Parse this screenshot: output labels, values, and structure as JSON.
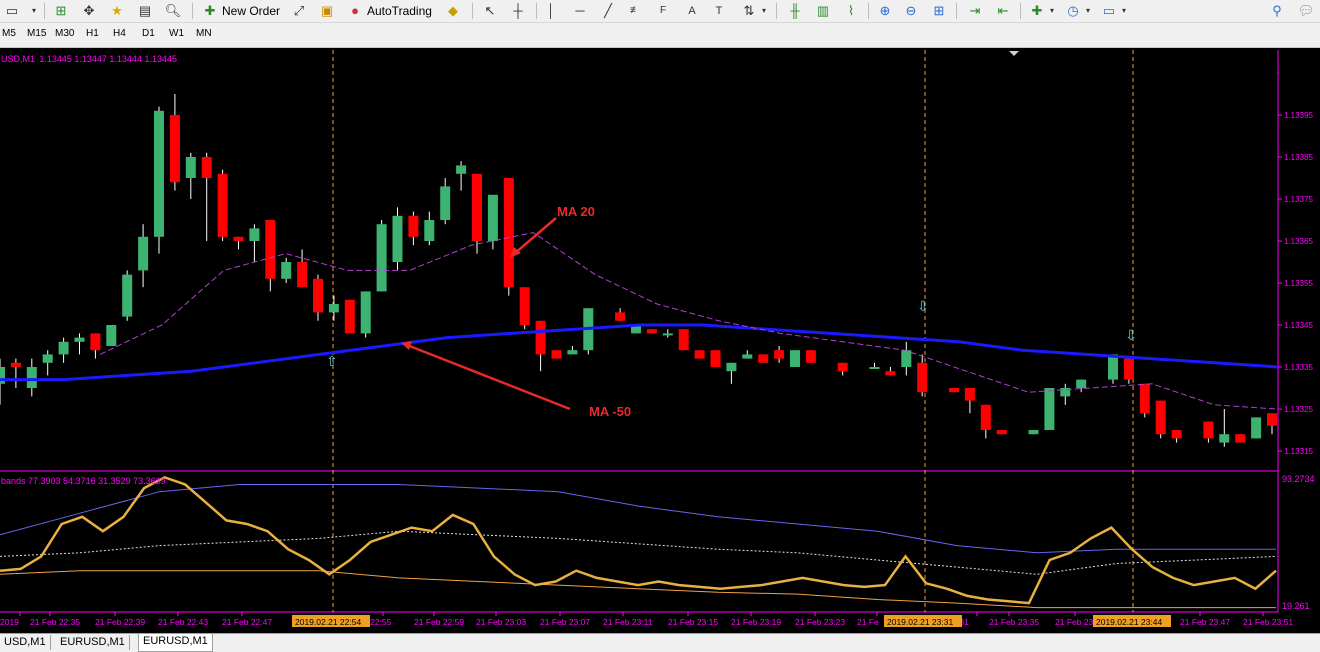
{
  "toolbar": {
    "new_order_label": "New Order",
    "autotrading_label": "AutoTrading"
  },
  "timeframes": [
    "M5",
    "M15",
    "M30",
    "H1",
    "H4",
    "D1",
    "W1",
    "MN"
  ],
  "chart": {
    "symbol_label": "USD,M1",
    "ohlc_text": "1.13445 1.13447 1.13444 1.13445",
    "price_ticks": [
      "1.13405",
      "1.13395",
      "1.13385",
      "1.13375",
      "1.13365",
      "1.13355",
      "1.13345",
      "1.13335",
      "1.13325",
      "1.13315"
    ],
    "current_price": "1.13445",
    "colors": {
      "bull": "#3cb371",
      "bear": "#ff0000",
      "ma_slow": "#1a1aff",
      "ma_fast": "#b040d0",
      "axis": "#ff00ff",
      "vline": "#f0a040"
    },
    "annotations": [
      {
        "text": "MA 20",
        "color": "#e82a2a"
      },
      {
        "text": "MA -50",
        "color": "#e82a2a"
      }
    ],
    "candles": [
      {
        "o": 1.13331,
        "h": 1.13337,
        "l": 1.13326,
        "c": 1.13335
      },
      {
        "o": 1.13336,
        "h": 1.13337,
        "l": 1.1333,
        "c": 1.13335
      },
      {
        "o": 1.1333,
        "h": 1.13337,
        "l": 1.13328,
        "c": 1.13335
      },
      {
        "o": 1.13336,
        "h": 1.13339,
        "l": 1.13333,
        "c": 1.13338
      },
      {
        "o": 1.13338,
        "h": 1.13342,
        "l": 1.13336,
        "c": 1.13341
      },
      {
        "o": 1.13341,
        "h": 1.13343,
        "l": 1.13338,
        "c": 1.13342
      },
      {
        "o": 1.13343,
        "h": 1.13343,
        "l": 1.13337,
        "c": 1.13339
      },
      {
        "o": 1.1334,
        "h": 1.13345,
        "l": 1.1334,
        "c": 1.13345
      },
      {
        "o": 1.13347,
        "h": 1.13358,
        "l": 1.13346,
        "c": 1.13357
      },
      {
        "o": 1.13358,
        "h": 1.13369,
        "l": 1.13354,
        "c": 1.13366
      },
      {
        "o": 1.13366,
        "h": 1.13397,
        "l": 1.13362,
        "c": 1.13396
      },
      {
        "o": 1.13395,
        "h": 1.134,
        "l": 1.13377,
        "c": 1.13379
      },
      {
        "o": 1.1338,
        "h": 1.13386,
        "l": 1.13375,
        "c": 1.13385
      },
      {
        "o": 1.13385,
        "h": 1.13386,
        "l": 1.13365,
        "c": 1.1338
      },
      {
        "o": 1.13381,
        "h": 1.13382,
        "l": 1.13365,
        "c": 1.13366
      },
      {
        "o": 1.13366,
        "h": 1.13366,
        "l": 1.13363,
        "c": 1.13365
      },
      {
        "o": 1.13365,
        "h": 1.13369,
        "l": 1.1336,
        "c": 1.13368
      },
      {
        "o": 1.1337,
        "h": 1.1337,
        "l": 1.13353,
        "c": 1.13356
      },
      {
        "o": 1.13356,
        "h": 1.13361,
        "l": 1.13355,
        "c": 1.1336
      },
      {
        "o": 1.1336,
        "h": 1.13363,
        "l": 1.13354,
        "c": 1.13354
      },
      {
        "o": 1.13356,
        "h": 1.13357,
        "l": 1.13346,
        "c": 1.13348
      },
      {
        "o": 1.13348,
        "h": 1.13352,
        "l": 1.13346,
        "c": 1.1335
      },
      {
        "o": 1.13351,
        "h": 1.13351,
        "l": 1.13343,
        "c": 1.13343
      },
      {
        "o": 1.13343,
        "h": 1.13353,
        "l": 1.13342,
        "c": 1.13353
      },
      {
        "o": 1.13353,
        "h": 1.1337,
        "l": 1.13353,
        "c": 1.13369
      },
      {
        "o": 1.1336,
        "h": 1.13373,
        "l": 1.13358,
        "c": 1.13371
      },
      {
        "o": 1.13371,
        "h": 1.13372,
        "l": 1.13364,
        "c": 1.13366
      },
      {
        "o": 1.13365,
        "h": 1.13372,
        "l": 1.13364,
        "c": 1.1337
      },
      {
        "o": 1.1337,
        "h": 1.1338,
        "l": 1.13369,
        "c": 1.13378
      },
      {
        "o": 1.13381,
        "h": 1.13384,
        "l": 1.13377,
        "c": 1.13383
      },
      {
        "o": 1.13381,
        "h": 1.13381,
        "l": 1.13362,
        "c": 1.13365
      },
      {
        "o": 1.13365,
        "h": 1.13376,
        "l": 1.13363,
        "c": 1.13376
      },
      {
        "o": 1.1338,
        "h": 1.1338,
        "l": 1.13352,
        "c": 1.13354
      },
      {
        "o": 1.13354,
        "h": 1.13354,
        "l": 1.13344,
        "c": 1.13345
      },
      {
        "o": 1.13346,
        "h": 1.13346,
        "l": 1.13334,
        "c": 1.13338
      },
      {
        "o": 1.13339,
        "h": 1.13339,
        "l": 1.13337,
        "c": 1.13337
      },
      {
        "o": 1.13338,
        "h": 1.1334,
        "l": 1.13338,
        "c": 1.13339
      },
      {
        "o": 1.13339,
        "h": 1.13349,
        "l": 1.13338,
        "c": 1.13349
      },
      null,
      {
        "o": 1.13348,
        "h": 1.13349,
        "l": 1.13346,
        "c": 1.13346
      },
      {
        "o": 1.13343,
        "h": 1.13345,
        "l": 1.13343,
        "c": 1.13345
      },
      {
        "o": 1.13344,
        "h": 1.13344,
        "l": 1.13343,
        "c": 1.13343
      },
      {
        "o": 1.13343,
        "h": 1.13344,
        "l": 1.13342,
        "c": 1.13343
      },
      {
        "o": 1.13344,
        "h": 1.13344,
        "l": 1.13339,
        "c": 1.13339
      },
      {
        "o": 1.13339,
        "h": 1.13339,
        "l": 1.13337,
        "c": 1.13337
      },
      {
        "o": 1.13339,
        "h": 1.13339,
        "l": 1.13335,
        "c": 1.13335
      },
      {
        "o": 1.13334,
        "h": 1.13336,
        "l": 1.13331,
        "c": 1.13336
      },
      {
        "o": 1.13337,
        "h": 1.13339,
        "l": 1.13337,
        "c": 1.13338
      },
      {
        "o": 1.13338,
        "h": 1.13338,
        "l": 1.13336,
        "c": 1.13336
      },
      {
        "o": 1.13339,
        "h": 1.1334,
        "l": 1.13336,
        "c": 1.13337
      },
      {
        "o": 1.13335,
        "h": 1.13339,
        "l": 1.13335,
        "c": 1.13339
      },
      {
        "o": 1.13339,
        "h": 1.13339,
        "l": 1.13336,
        "c": 1.13336
      },
      null,
      {
        "o": 1.13336,
        "h": 1.13336,
        "l": 1.13333,
        "c": 1.13334
      },
      null,
      {
        "o": 1.13335,
        "h": 1.13336,
        "l": 1.13335,
        "c": 1.13335
      },
      {
        "o": 1.13334,
        "h": 1.13335,
        "l": 1.13333,
        "c": 1.13333
      },
      {
        "o": 1.13335,
        "h": 1.13341,
        "l": 1.13333,
        "c": 1.13339
      },
      {
        "o": 1.13336,
        "h": 1.13338,
        "l": 1.13328,
        "c": 1.13329
      },
      null,
      {
        "o": 1.1333,
        "h": 1.1333,
        "l": 1.13329,
        "c": 1.13329
      },
      {
        "o": 1.1333,
        "h": 1.1333,
        "l": 1.13324,
        "c": 1.13327
      },
      {
        "o": 1.13326,
        "h": 1.13326,
        "l": 1.13318,
        "c": 1.1332
      },
      {
        "o": 1.1332,
        "h": 1.1332,
        "l": 1.13319,
        "c": 1.13319
      },
      null,
      {
        "o": 1.13319,
        "h": 1.1332,
        "l": 1.13319,
        "c": 1.1332
      },
      {
        "o": 1.1332,
        "h": 1.1333,
        "l": 1.1332,
        "c": 1.1333
      },
      {
        "o": 1.13328,
        "h": 1.13331,
        "l": 1.13326,
        "c": 1.1333
      },
      {
        "o": 1.1333,
        "h": 1.13332,
        "l": 1.13329,
        "c": 1.13332
      },
      null,
      {
        "o": 1.13332,
        "h": 1.13338,
        "l": 1.13331,
        "c": 1.13338
      },
      {
        "o": 1.13337,
        "h": 1.13337,
        "l": 1.13331,
        "c": 1.13332
      },
      {
        "o": 1.13331,
        "h": 1.13331,
        "l": 1.13323,
        "c": 1.13324
      },
      {
        "o": 1.13327,
        "h": 1.13327,
        "l": 1.13318,
        "c": 1.13319
      },
      {
        "o": 1.1332,
        "h": 1.1332,
        "l": 1.13317,
        "c": 1.13318
      },
      null,
      {
        "o": 1.13322,
        "h": 1.13322,
        "l": 1.13317,
        "c": 1.13318
      },
      {
        "o": 1.13317,
        "h": 1.13325,
        "l": 1.13316,
        "c": 1.13319
      },
      {
        "o": 1.13319,
        "h": 1.13319,
        "l": 1.13317,
        "c": 1.13317
      },
      {
        "o": 1.13318,
        "h": 1.13323,
        "l": 1.13318,
        "c": 1.13323
      },
      {
        "o": 1.13324,
        "h": 1.13324,
        "l": 1.13319,
        "c": 1.13321
      }
    ],
    "ma50": [
      1.13332,
      1.13332,
      1.13333,
      1.13334,
      1.13336,
      1.13338,
      1.1334,
      1.13342,
      1.13343,
      1.13344,
      1.13345,
      1.13345,
      1.13344,
      1.13343,
      1.13342,
      1.13341,
      1.13339,
      1.13338,
      1.13337,
      1.13336,
      1.13335
    ],
    "ma20": [
      1.13338,
      1.13345,
      1.13358,
      1.13362,
      1.13358,
      1.13358,
      1.13364,
      1.13367,
      1.13357,
      1.1335,
      1.13346,
      1.13343,
      1.13341,
      1.13339,
      1.13334,
      1.13329,
      1.1333,
      1.13331,
      1.13326,
      1.13325
    ]
  },
  "indicator": {
    "label_text": "bands 77.3903 54.3716 31.3529 73.3639",
    "max_label": "93.2734",
    "min_label": "19.261",
    "range": [
      19.261,
      93.2734
    ],
    "main": [
      40,
      41,
      48,
      66,
      70,
      62,
      70,
      86,
      92,
      88,
      78,
      68,
      66,
      62,
      52,
      46,
      38,
      46,
      56,
      60,
      64,
      62,
      71,
      66,
      48,
      38,
      32,
      34,
      40,
      36,
      34,
      32,
      34,
      32,
      31,
      30,
      31,
      32,
      34,
      36,
      34,
      32,
      31,
      32,
      48,
      33,
      30,
      26,
      24,
      23,
      22,
      46,
      50,
      58,
      64,
      52,
      42,
      36,
      32,
      34,
      36,
      30,
      40
    ],
    "upper": [
      60,
      72,
      84,
      88,
      88,
      88,
      86,
      84,
      76,
      70,
      66,
      62,
      54,
      50,
      52,
      52,
      52
    ],
    "middle": [
      48,
      50,
      54,
      56,
      58,
      62,
      60,
      58,
      55,
      52,
      50,
      46,
      42,
      38,
      44,
      46,
      48
    ],
    "lower": [
      38,
      40,
      40,
      40,
      40,
      36,
      34,
      32,
      30,
      28,
      27,
      24,
      22,
      19.5,
      19.5,
      19.5,
      19.5
    ]
  },
  "time_axis": {
    "labels": [
      "2019",
      "21 Feb 22:35",
      "21 Feb 22:39",
      "21 Feb 22:43",
      "21 Feb 22:47",
      "5 22:55",
      "21 Feb 22:59",
      "21 Feb 23:03",
      "21 Feb 23:07",
      "21 Feb 23:11",
      "21 Feb 23:15",
      "21 Feb 23:19",
      "21 Feb 23:23",
      "21 Fe",
      ":31",
      "21 Feb 23:35",
      "21 Feb 23",
      "21 Feb 23:47",
      "21 Feb 23:51"
    ],
    "highlights": [
      "2019.02.21 22:54",
      "2019.02.21 23:31",
      "2019.02.21 23:44"
    ]
  },
  "tabs": [
    {
      "label": "USD,M1",
      "active": false
    },
    {
      "label": "EURUSD,M1",
      "active": false
    },
    {
      "label": "EURUSD,M1",
      "active": true
    }
  ]
}
